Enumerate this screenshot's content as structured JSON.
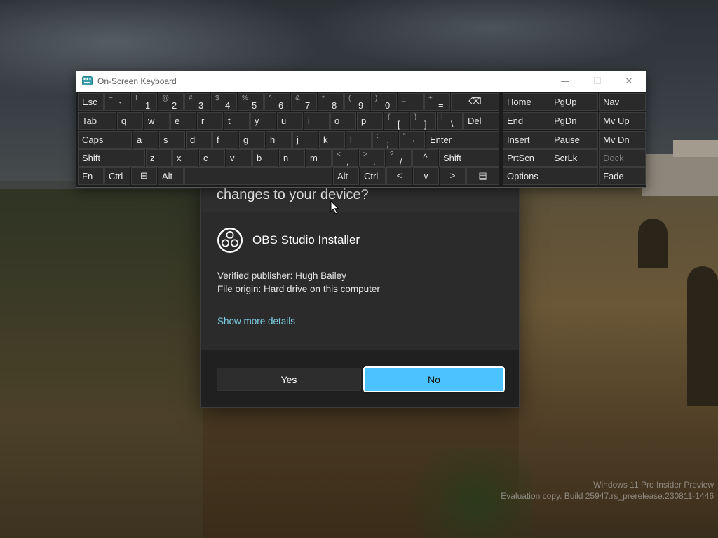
{
  "watermark": {
    "line1": "Windows 11 Pro Insider Preview",
    "line2": "Evaluation copy. Build 25947.rs_prerelease.230811-1446"
  },
  "uac": {
    "title": "changes to your device?",
    "app_name": "OBS Studio Installer",
    "publisher": "Verified publisher: Hugh Bailey",
    "origin": "File origin: Hard drive on this computer",
    "details_link": "Show more details",
    "yes_label": "Yes",
    "no_label": "No",
    "accent_color": "#4cc2ff",
    "link_color": "#7fd0e6"
  },
  "osk": {
    "title": "On-Screen Keyboard",
    "app_icon": "keyboard-icon",
    "controls": {
      "minimize": "—",
      "maximize": "☐",
      "close": "✕"
    },
    "rows": [
      [
        {
          "label": "Esc"
        },
        {
          "shift": "~",
          "main": "`"
        },
        {
          "shift": "!",
          "main": "1"
        },
        {
          "shift": "@",
          "main": "2"
        },
        {
          "shift": "#",
          "main": "3"
        },
        {
          "shift": "$",
          "main": "4"
        },
        {
          "shift": "%",
          "main": "5"
        },
        {
          "shift": "^",
          "main": "6"
        },
        {
          "shift": "&",
          "main": "7"
        },
        {
          "shift": "*",
          "main": "8"
        },
        {
          "shift": "(",
          "main": "9"
        },
        {
          "shift": ")",
          "main": "0"
        },
        {
          "shift": "_",
          "main": "-"
        },
        {
          "shift": "+",
          "main": "="
        },
        {
          "label": "⌫",
          "icon": "backspace-icon"
        },
        {
          "label": "Home"
        },
        {
          "label": "PgUp"
        },
        {
          "label": "Nav"
        }
      ],
      [
        {
          "label": "Tab"
        },
        {
          "label": "q"
        },
        {
          "label": "w"
        },
        {
          "label": "e"
        },
        {
          "label": "r"
        },
        {
          "label": "t"
        },
        {
          "label": "y"
        },
        {
          "label": "u"
        },
        {
          "label": "i"
        },
        {
          "label": "o"
        },
        {
          "label": "p"
        },
        {
          "shift": "{",
          "main": "["
        },
        {
          "shift": "}",
          "main": "]"
        },
        {
          "shift": "|",
          "main": "\\"
        },
        {
          "label": "Del"
        },
        {
          "label": "End"
        },
        {
          "label": "PgDn"
        },
        {
          "label": "Mv Up"
        }
      ],
      [
        {
          "label": "Caps"
        },
        {
          "label": "a"
        },
        {
          "label": "s"
        },
        {
          "label": "d"
        },
        {
          "label": "f"
        },
        {
          "label": "g"
        },
        {
          "label": "h"
        },
        {
          "label": "j"
        },
        {
          "label": "k"
        },
        {
          "label": "l"
        },
        {
          "shift": ":",
          "main": ";"
        },
        {
          "shift": "\"",
          "main": "'"
        },
        {
          "label": "Enter"
        },
        {
          "label": "Insert"
        },
        {
          "label": "Pause"
        },
        {
          "label": "Mv Dn"
        }
      ],
      [
        {
          "label": "Shift"
        },
        {
          "label": "z"
        },
        {
          "label": "x"
        },
        {
          "label": "c"
        },
        {
          "label": "v"
        },
        {
          "label": "b"
        },
        {
          "label": "n"
        },
        {
          "label": "m"
        },
        {
          "shift": "<",
          "main": ","
        },
        {
          "shift": ">",
          "main": "."
        },
        {
          "shift": "?",
          "main": "/"
        },
        {
          "label": "^",
          "icon": "arrow-up-icon"
        },
        {
          "label": "Shift"
        },
        {
          "label": "PrtScn"
        },
        {
          "label": "ScrLk"
        },
        {
          "label": "Dock",
          "dim": true
        }
      ],
      [
        {
          "label": "Fn"
        },
        {
          "label": "Ctrl"
        },
        {
          "label": "⊞",
          "icon": "windows-logo-icon"
        },
        {
          "label": "Alt"
        },
        {
          "label": "",
          "icon": "spacebar"
        },
        {
          "label": "Alt"
        },
        {
          "label": "Ctrl"
        },
        {
          "label": "<",
          "icon": "arrow-left-icon"
        },
        {
          "label": "v",
          "icon": "arrow-down-icon"
        },
        {
          "label": ">",
          "icon": "arrow-right-icon"
        },
        {
          "label": "▤",
          "icon": "menu-key-icon"
        },
        {
          "label": "Options"
        },
        {
          "label": "Fade"
        }
      ]
    ]
  }
}
